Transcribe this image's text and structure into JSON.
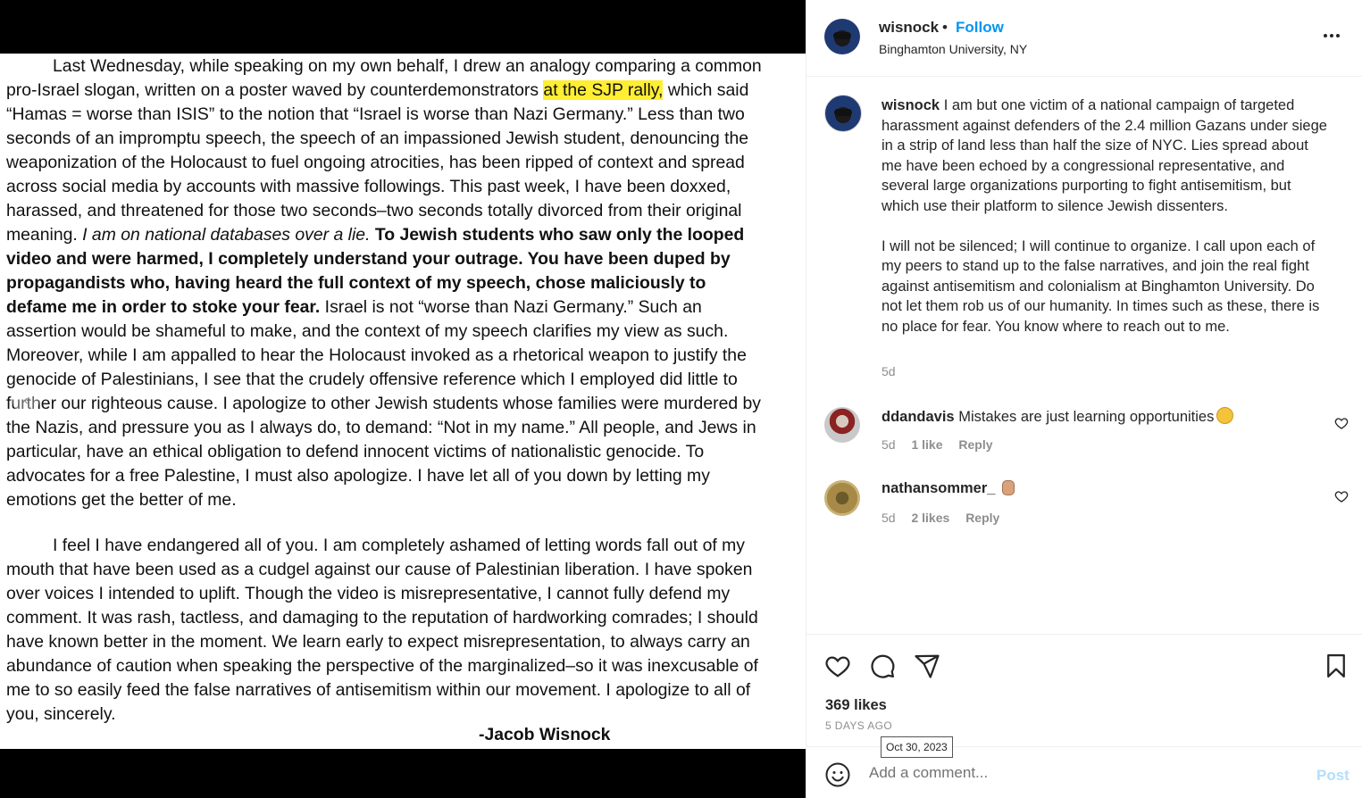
{
  "post": {
    "username": "wisnock",
    "dot": "•",
    "follow_label": "Follow",
    "location": "Binghamton University, NY",
    "more_icon": "more-horizontal-icon"
  },
  "image": {
    "para1_lines": [
      "Last Wednesday, while speaking on my own behalf, I drew an analogy comparing a common",
      "pro-Israel slogan, written on a poster waved by counterdemonstrators ",
      "at the SJP rally,",
      " which said",
      "“Hamas = worse than ISIS” to the notion that “Israel is worse than Nazi Germany.” Less than two",
      "seconds of an impromptu speech, the speech of an impassioned Jewish student, denouncing the",
      "weaponization of the Holocaust to fuel ongoing atrocities, has been ripped of context and spread",
      "across social media by accounts with massive followings. This past week, I have been doxxed,",
      "harassed, and threatened for those two seconds–two seconds totally divorced from their original",
      "meaning. ",
      "I am on national databases over a lie.",
      " ",
      "To Jewish students who saw only the looped",
      "video and were harmed, I completely understand your outrage. You have been duped by",
      "propagandists who, having heard the full context of my speech, chose maliciously to",
      "defame me in order to stoke your fear.",
      " Israel is not “worse than Nazi Germany.” Such an",
      "assertion would be shameful to make, and the context of my speech clarifies my view as such.",
      "Moreover, while I am appalled to hear the Holocaust invoked as a rhetorical weapon to justify the",
      "genocide of Palestinians, I see that the crudely offensive reference which I employed did little to",
      "further our righteous cause. I apologize to other Jewish students whose families were murdered by",
      "the Nazis, and pressure you as I always do, to demand: “Not in my name.” All people, and Jews in",
      "particular, have an ethical obligation to defend innocent victims of nationalistic genocide. To",
      "advocates for a free Palestine, I must also apologize. I have let all of you down by letting my",
      "emotions get the better of me."
    ],
    "para2_lines": [
      "I feel I have endangered all of you. I am completely ashamed of letting words fall out of my",
      "mouth that have been used as a cudgel against our cause of Palestinian liberation. I have spoken",
      "over voices I intended to uplift. Though the video is misrepresentative, I cannot fully defend my",
      "comment. It was rash, tactless, and damaging to the reputation of hardworking comrades; I should",
      "have known better in the moment. We learn early to expect misrepresentation, to always carry an",
      "abundance of caution when speaking the perspective of the marginalized–so it was inexcusable of",
      "me to so easily feed the false narratives of antisemitism within our movement. I apologize to all of",
      "you, sincerely."
    ],
    "signature": "-Jacob Wisnock",
    "prev_icon": "chevron-left-icon",
    "highlight_color": "#ffee32"
  },
  "caption": {
    "username": "wisnock",
    "text_p1": "I am but one victim of a national campaign of targeted harassment against defenders of the 2.4 million Gazans under siege in a strip of land less than half the size of NYC. Lies spread about me have been echoed by a congressional representative, and several large organizations purporting to fight antisemitism, but which use their platform to silence Jewish dissenters.",
    "text_p2": "I will not be silenced; I will continue to organize. I call upon each of my peers to stand up to the false narratives, and join the real fight against antisemitism and colonialism at Binghamton University. Do not let them rob us of our humanity. In times such as these, there is no place for fear. You know where to reach out to me.",
    "time": "5d"
  },
  "comments": [
    {
      "username": "ddandavis",
      "text": "Mistakes are just learning opportunities",
      "emoji": "grinning-face-emoji",
      "time": "5d",
      "likes": "1 like",
      "reply": "Reply"
    },
    {
      "username": "nathansommer_",
      "text": "",
      "emoji": "raised-fist-emoji",
      "time": "5d",
      "likes": "2 likes",
      "reply": "Reply"
    }
  ],
  "actions": {
    "likes": "369 likes",
    "posted_ago": "5 DAYS AGO",
    "date_tooltip": "Oct 30, 2023"
  },
  "comment_bar": {
    "placeholder": "Add a comment...",
    "post_label": "Post"
  },
  "colors": {
    "follow": "#0095f6",
    "post_disabled": "#b2dffc",
    "muted": "#8e8e8e"
  }
}
